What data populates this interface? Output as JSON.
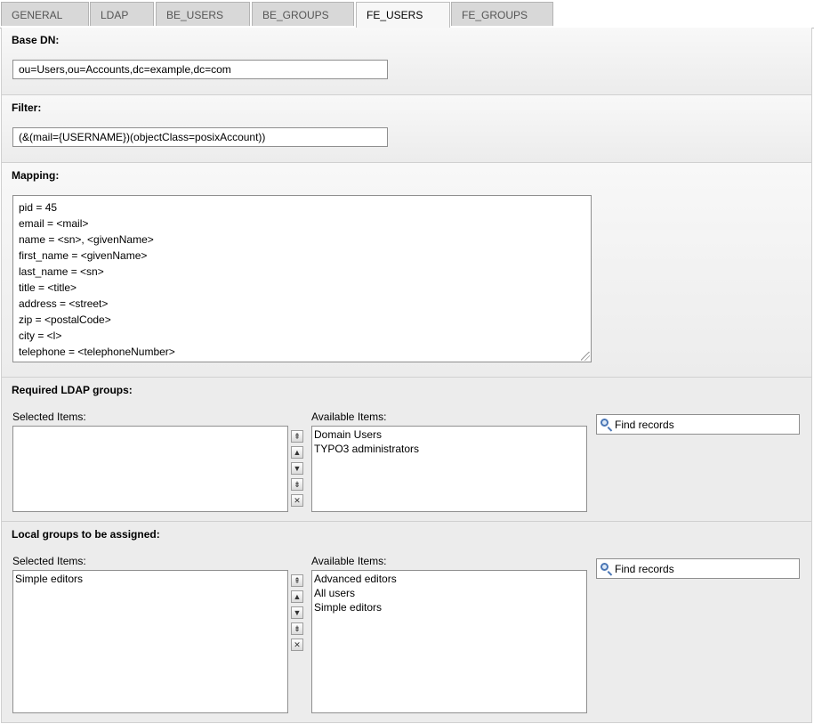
{
  "tabs": [
    {
      "label": "GENERAL"
    },
    {
      "label": "LDAP"
    },
    {
      "label": "BE_USERS"
    },
    {
      "label": "BE_GROUPS"
    },
    {
      "label": "FE_USERS"
    },
    {
      "label": "FE_GROUPS"
    }
  ],
  "active_tab": "FE_USERS",
  "base_dn": {
    "title": "Base DN:",
    "value": "ou=Users,ou=Accounts,dc=example,dc=com"
  },
  "filter": {
    "title": "Filter:",
    "value": "(&(mail={USERNAME})(objectClass=posixAccount))"
  },
  "mapping": {
    "title": "Mapping:",
    "lines": [
      "pid = 45",
      "email = <mail>",
      "name = <sn>, <givenName>",
      "first_name = <givenName>",
      "last_name = <sn>",
      "title = <title>",
      "address = <street>",
      "zip = <postalCode>",
      "city = <l>",
      "telephone = <telephoneNumber>"
    ]
  },
  "required_groups": {
    "title": "Required LDAP groups:",
    "selected_label": "Selected Items:",
    "available_label": "Available Items:",
    "selected": [],
    "available": [
      "Domain Users",
      "TYPO3 administrators"
    ],
    "find_label": "Find records"
  },
  "local_groups": {
    "title": "Local groups to be assigned:",
    "selected_label": "Selected Items:",
    "available_label": "Available Items:",
    "selected": [
      "Simple editors"
    ],
    "available": [
      "Advanced editors",
      "All users",
      "Simple editors"
    ],
    "find_label": "Find records"
  },
  "controls": {
    "move_top_icon": "arrow-top-icon",
    "move_up_icon": "arrow-up-icon",
    "move_down_icon": "arrow-down-icon",
    "move_bottom_icon": "arrow-bottom-icon",
    "remove_icon": "close-icon"
  },
  "colors": {
    "background": "#ececec",
    "border": "#8f8f8f",
    "search_icon": "#4a76b5"
  }
}
